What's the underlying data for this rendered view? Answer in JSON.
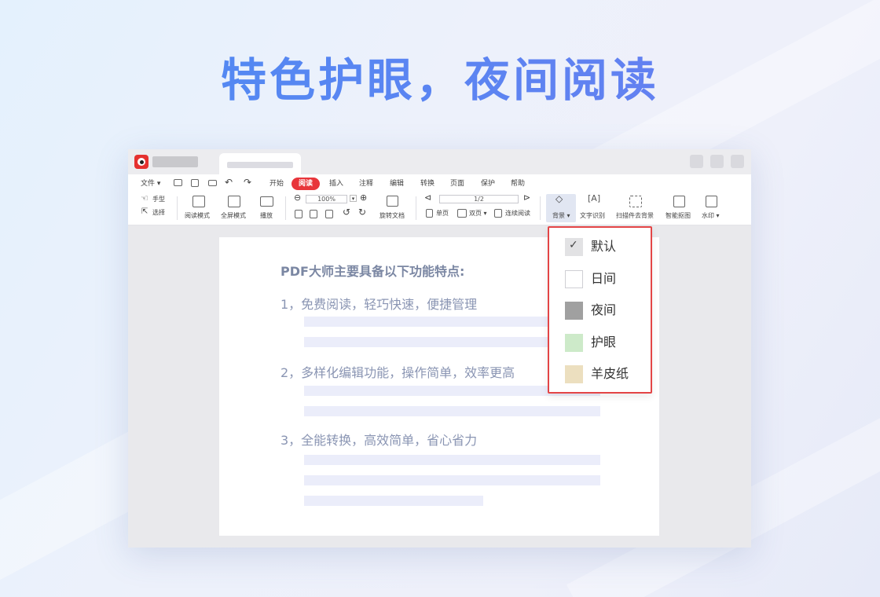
{
  "headline": "特色护眼，夜间阅读",
  "menu": [
    {
      "label": "文件 ▾"
    },
    {
      "label": "开始"
    },
    {
      "label": "阅读",
      "active": true
    },
    {
      "label": "插入"
    },
    {
      "label": "注释"
    },
    {
      "label": "编辑"
    },
    {
      "label": "转换"
    },
    {
      "label": "页面"
    },
    {
      "label": "保护"
    },
    {
      "label": "帮助"
    }
  ],
  "toolbar": {
    "hand": "手型",
    "select": "选择",
    "read_mode": "阅读模式",
    "fullscreen": "全屏模式",
    "play": "播放",
    "zoom": "100%",
    "rotate": "旋转文档",
    "page_indicator": "1/2",
    "single_page": "单页",
    "double_page": "双页 ▾",
    "continuous": "连续阅读",
    "background": "背景 ▾",
    "ocr": "文字识别",
    "scan_remove_bg": "扫描件去背景",
    "smart_cutout": "智能抠图",
    "watermark": "水印 ▾"
  },
  "document": {
    "title": "PDF大师主要具备以下功能特点:",
    "items": [
      "1，免费阅读，轻巧快速，便捷管理",
      "2，多样化编辑功能，操作简单，效率更高",
      "3，全能转换，高效简单，省心省力"
    ]
  },
  "background_menu": {
    "options": [
      {
        "label": "默认",
        "color": "#e2e2e4",
        "checked": true
      },
      {
        "label": "日间",
        "color": "#ffffff"
      },
      {
        "label": "夜间",
        "color": "#a0a0a0"
      },
      {
        "label": "护眼",
        "color": "#cdeac9"
      },
      {
        "label": "羊皮纸",
        "color": "#ecdfbf"
      }
    ]
  },
  "colors": {
    "accent": "#e8353b",
    "headline": "#4c8cf3"
  }
}
